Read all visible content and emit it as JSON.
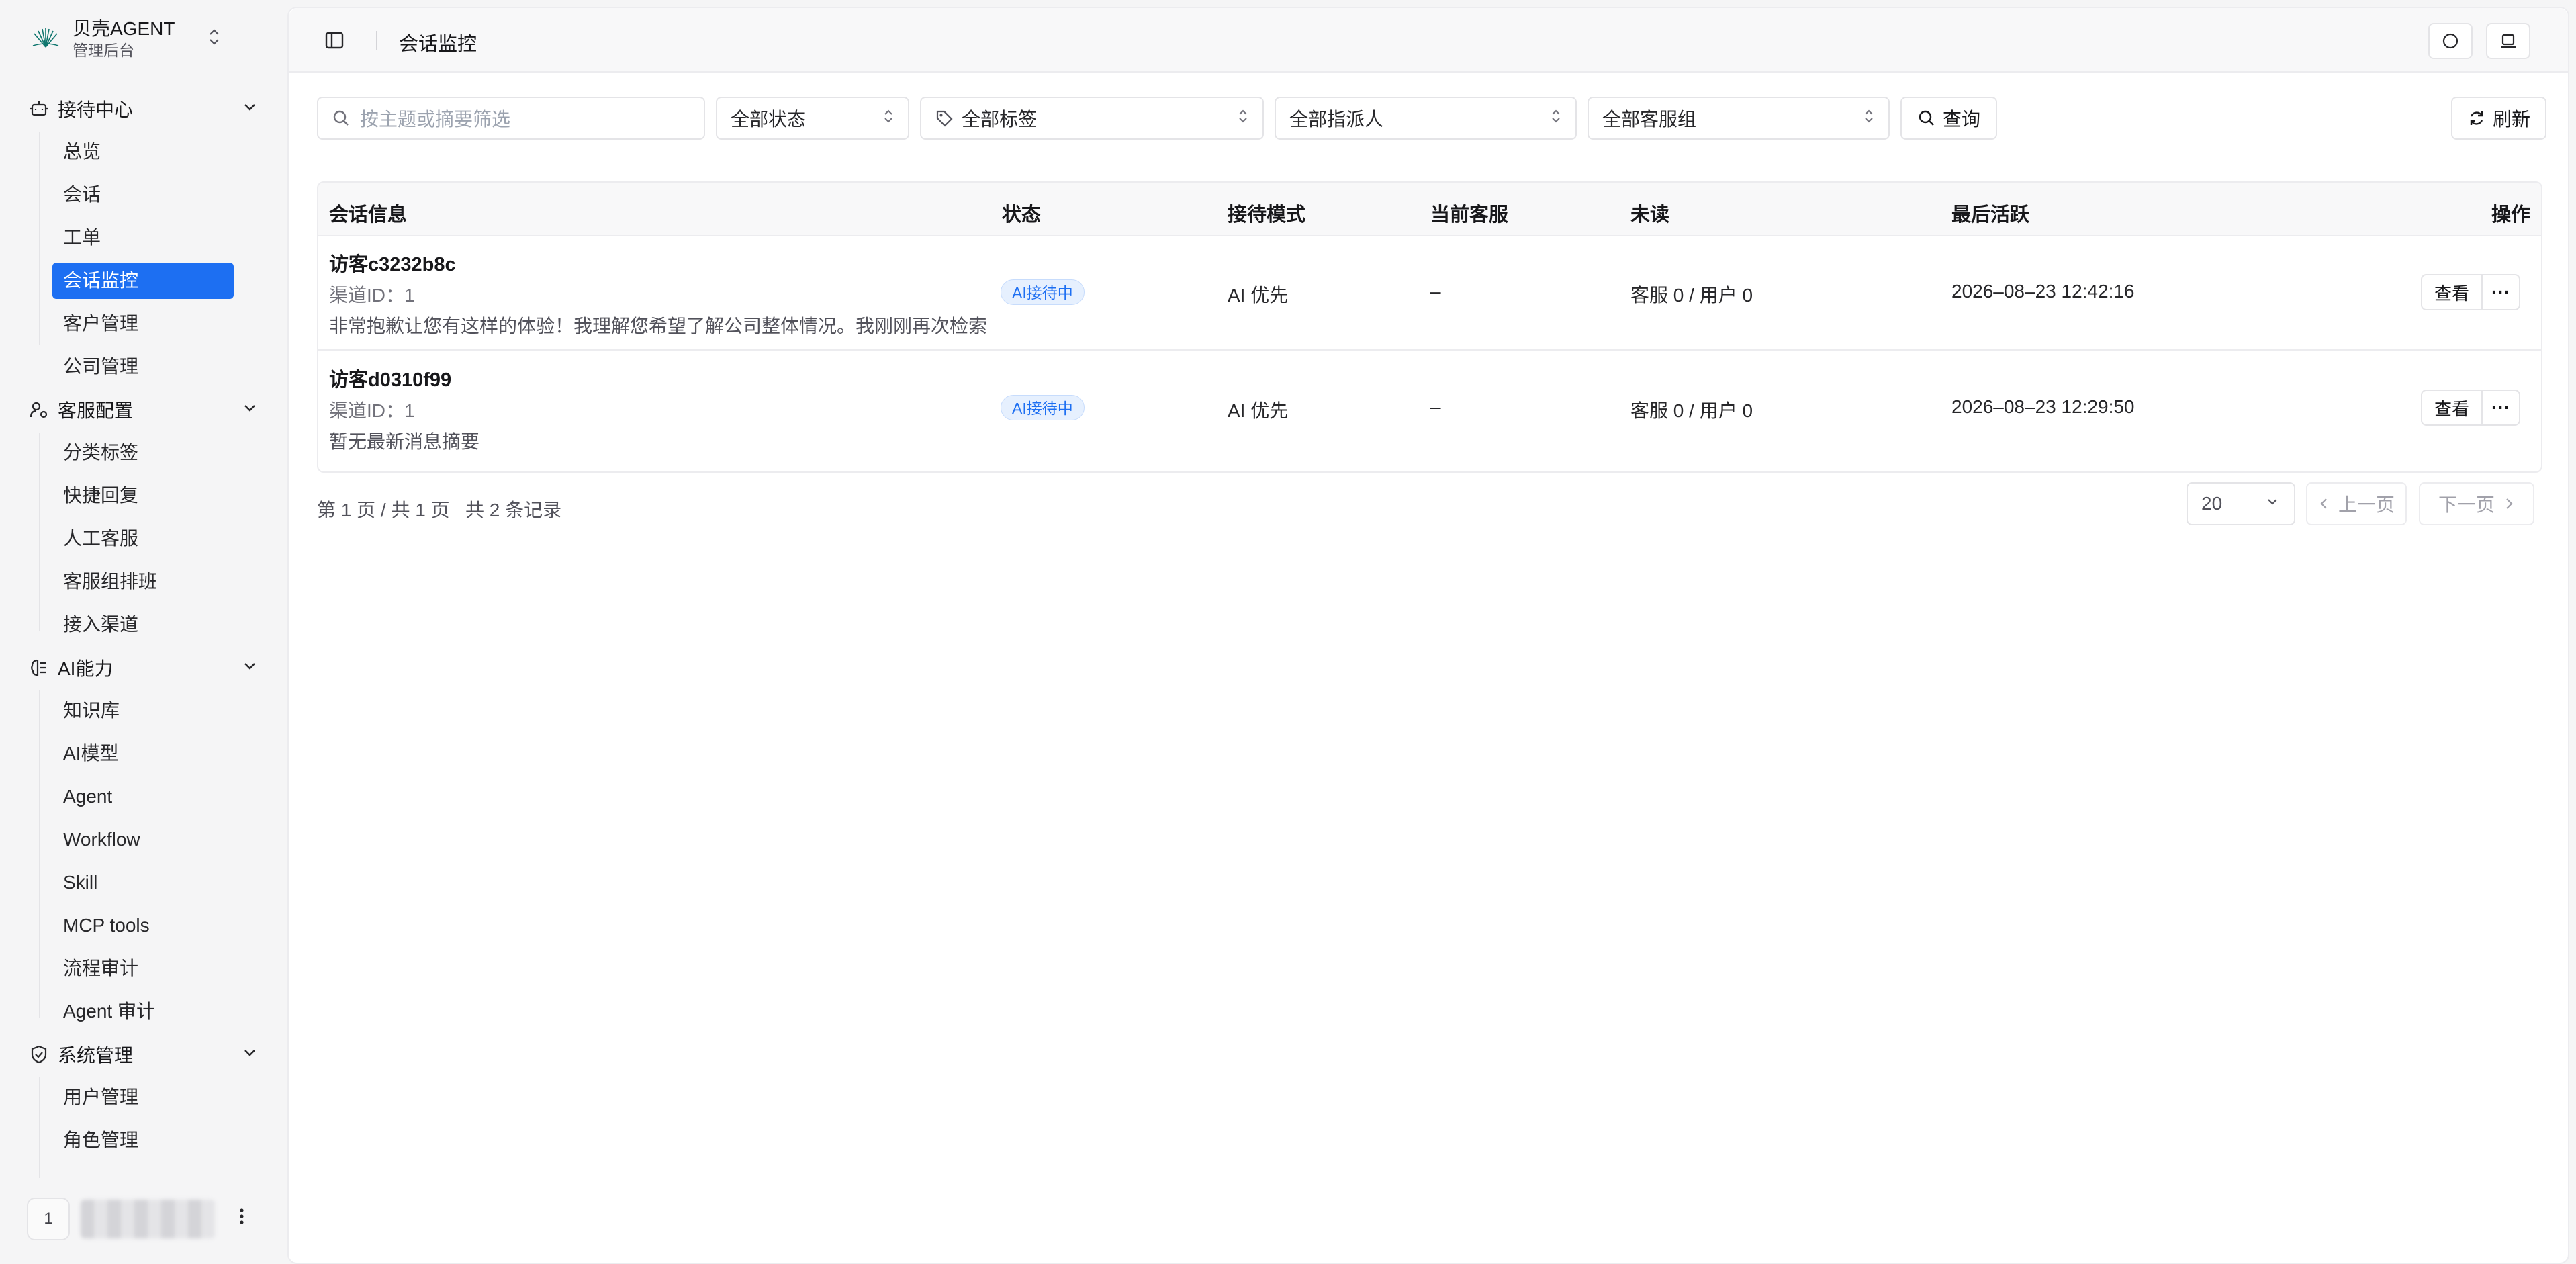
{
  "brand": {
    "name": "贝壳AGENT",
    "subtitle": "管理后台"
  },
  "sidebar": {
    "groups": [
      {
        "label": "接待中心",
        "icon": "bot-icon",
        "items": [
          "总览",
          "会话",
          "工单",
          "会话监控",
          "客户管理",
          "公司管理"
        ]
      },
      {
        "label": "客服配置",
        "icon": "user-cog-icon",
        "items": [
          "分类标签",
          "快捷回复",
          "人工客服",
          "客服组排班",
          "接入渠道"
        ]
      },
      {
        "label": "AI能力",
        "icon": "brain-icon",
        "items": [
          "知识库",
          "AI模型",
          "Agent",
          "Workflow",
          "Skill",
          "MCP tools",
          "流程审计",
          "Agent 审计"
        ]
      },
      {
        "label": "系统管理",
        "icon": "shield-icon",
        "items": [
          "用户管理",
          "角色管理"
        ]
      }
    ],
    "active_item": "会话监控",
    "user": {
      "avatar": "1"
    }
  },
  "topbar": {
    "title": "会话监控"
  },
  "filters": {
    "search_placeholder": "按主题或摘要筛选",
    "status": "全部状态",
    "tags": "全部标签",
    "assignee": "全部指派人",
    "group": "全部客服组",
    "query_label": "查询",
    "refresh_label": "刷新"
  },
  "table": {
    "headers": [
      "会话信息",
      "状态",
      "接待模式",
      "当前客服",
      "未读",
      "最后活跃",
      "操作"
    ],
    "rows": [
      {
        "title": "访客c3232b8c",
        "channel": "渠道ID：1",
        "summary": "非常抱歉让您有这样的体验！我理解您希望了解公司整体情况。我刚刚再次检索",
        "status": "AI接待中",
        "mode": "AI 优先",
        "agent": "–",
        "unread": "客服 0 / 用户 0",
        "last_active": "2026–08–23 12:42:16",
        "view_label": "查看"
      },
      {
        "title": "访客d0310f99",
        "channel": "渠道ID：1",
        "summary": "暂无最新消息摘要",
        "status": "AI接待中",
        "mode": "AI 优先",
        "agent": "–",
        "unread": "客服 0 / 用户 0",
        "last_active": "2026–08–23 12:29:50",
        "view_label": "查看"
      }
    ]
  },
  "pagination": {
    "info": "第 1 页 / 共 1 页   共 2 条记录",
    "page_size": "20",
    "prev_label": "上一页",
    "next_label": "下一页"
  },
  "colors": {
    "accent": "#1d6ff2",
    "badge_bg": "#e6f0fe"
  }
}
